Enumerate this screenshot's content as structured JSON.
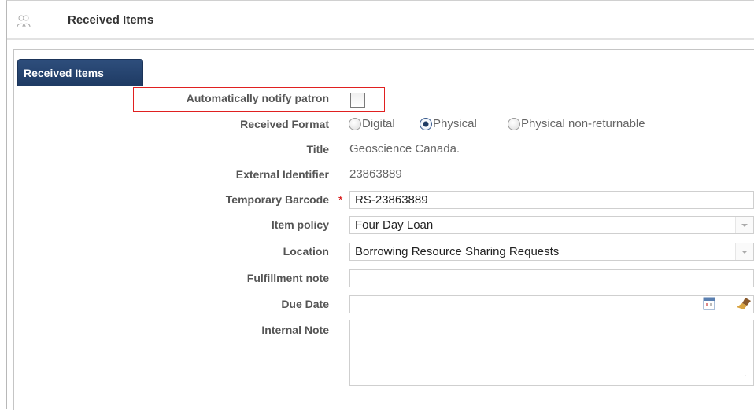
{
  "header": {
    "title": "Received Items",
    "icon": "users-icon"
  },
  "tabs": [
    {
      "label": "Received Items",
      "active": true
    }
  ],
  "form": {
    "notify": {
      "label": "Automatically notify patron",
      "checked": false
    },
    "received_format": {
      "label": "Received Format",
      "options": [
        "Digital",
        "Physical",
        "Physical non-returnable"
      ],
      "selected": "Physical"
    },
    "title": {
      "label": "Title",
      "value": "Geoscience Canada."
    },
    "external_identifier": {
      "label": "External Identifier",
      "value": "23863889"
    },
    "temporary_barcode": {
      "label": "Temporary Barcode",
      "required_mark": "*",
      "value": "RS-23863889"
    },
    "item_policy": {
      "label": "Item policy",
      "value": "Four Day Loan"
    },
    "location": {
      "label": "Location",
      "value": "Borrowing Resource Sharing Requests"
    },
    "fulfillment_note": {
      "label": "Fulfillment note",
      "value": ""
    },
    "due_date": {
      "label": "Due Date",
      "value": ""
    },
    "internal_note": {
      "label": "Internal Note",
      "value": ""
    }
  },
  "colors": {
    "tab_bg": "#1e3a63",
    "highlight": "#e02020",
    "required": "#d40000"
  }
}
